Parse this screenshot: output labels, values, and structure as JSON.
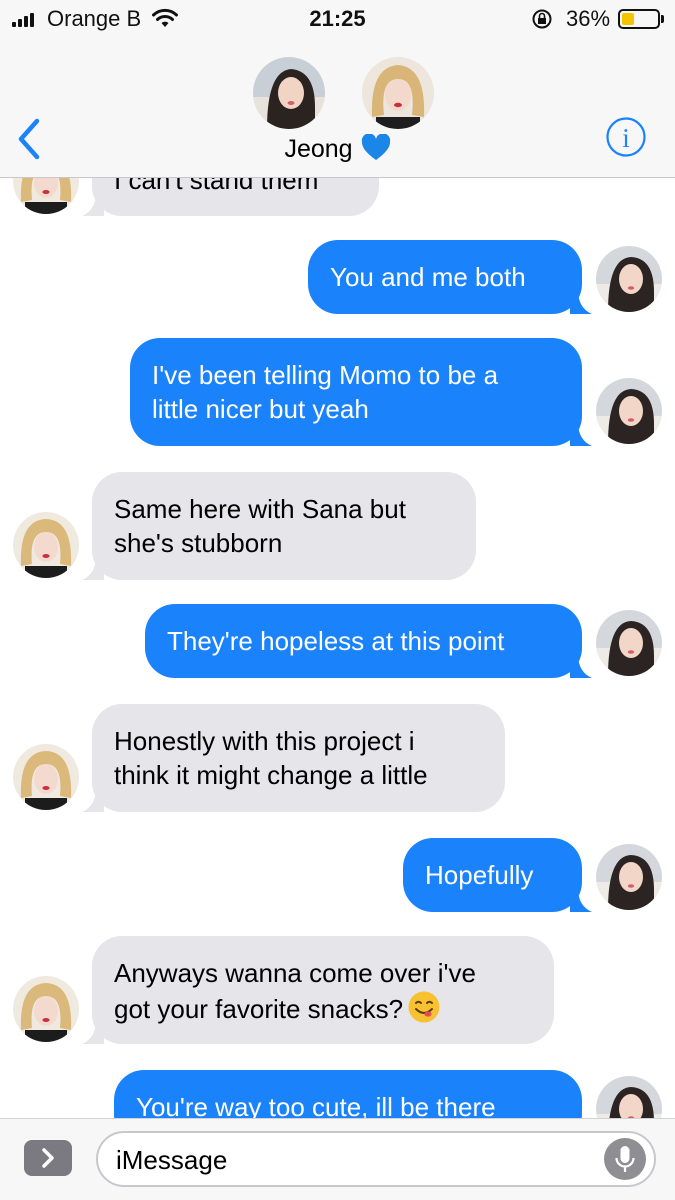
{
  "status_bar": {
    "carrier": "Orange B",
    "time": "21:25",
    "battery_percent": "36%",
    "battery_level": 0.36,
    "battery_color": "#f5c400",
    "icons": [
      "signal-icon",
      "wifi-icon",
      "rotation-lock-icon",
      "battery-icon"
    ]
  },
  "header": {
    "contact_name": "Jeong",
    "name_emoji": "blue-heart-icon",
    "back_icon": "chevron-left-icon",
    "info_icon": "info-icon",
    "accent_color": "#1a82fb"
  },
  "messages": [
    {
      "sender": "them",
      "lines": [
        "I can't stand them"
      ]
    },
    {
      "sender": "me",
      "lines": [
        "You and me both"
      ]
    },
    {
      "sender": "me",
      "lines": [
        "I've been telling Momo to be a",
        "little nicer but yeah"
      ]
    },
    {
      "sender": "them",
      "lines": [
        "Same here with Sana but",
        "she's stubborn"
      ]
    },
    {
      "sender": "me",
      "lines": [
        "They're hopeless at this point"
      ]
    },
    {
      "sender": "them",
      "lines": [
        "Honestly with this project i",
        "think it might change a little"
      ]
    },
    {
      "sender": "me",
      "lines": [
        "Hopefully"
      ]
    },
    {
      "sender": "them",
      "lines": [
        "Anyways wanna come over i've",
        "got your favorite snacks?"
      ],
      "emoji": "yum-face-emoji-icon"
    },
    {
      "sender": "me",
      "lines": [
        "You're way too cute, ill be there"
      ]
    }
  ],
  "colors": {
    "incoming_bubble": "#e5e5ea",
    "outgoing_bubble": "#1a82fb"
  },
  "input_bar": {
    "placeholder": "iMessage",
    "apps_icon": "chevron-right-icon",
    "mic_icon": "microphone-icon"
  }
}
